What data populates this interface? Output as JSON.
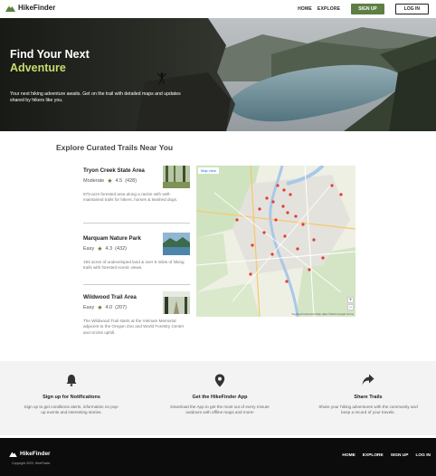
{
  "header": {
    "brand": "HikeFinder",
    "nav": {
      "home": "HOME",
      "explore": "EXPLORE"
    },
    "signup_label": "SIGN UP",
    "login_label": "LOG IN"
  },
  "hero": {
    "title_line1": "Find Your Next",
    "title_line2": "Adventure",
    "subtitle": "Your next hiking adventure awaits. Get on the trail with detailed maps and updates shared by hikers like you."
  },
  "trails_section": {
    "title": "Explore Curated Trails Near You",
    "trails": [
      {
        "name": "Tryon Creek State Area",
        "difficulty": "Moderate",
        "rating": "4.5",
        "reviews": "(428)",
        "description": "670-acre forested area along a ravine with well-maintained trails for hikers, horses & leashed dogs."
      },
      {
        "name": "Marquam Nature Park",
        "difficulty": "Easy",
        "rating": "4.3",
        "reviews": "(432)",
        "description": "193 acres of undeveloped land & over 5 miles of hiking trails with forested scenic views."
      },
      {
        "name": "Wildwood Trail Area",
        "difficulty": "Easy",
        "rating": "4.0",
        "reviews": "(207)",
        "description": "The Wildwood Trail starts at the Vietnam Memorial adjacent to the Oregon Zoo and World Forestry Center and circles uphill."
      }
    ]
  },
  "map": {
    "view_button": "Map view",
    "zoom_in": "+",
    "zoom_out": "−",
    "footer_text": "Keyboard shortcuts   Map data ©2024 Google   Terms"
  },
  "features": [
    {
      "icon": "bell-icon",
      "title": "Sign up for Notifications",
      "text": "Sign up to get conditions alerts, information on pop-up events and interesting stories."
    },
    {
      "icon": "location-pin-icon",
      "title": "Get the HikeFinder App",
      "text": "Download the App to get the most out of every minute outdoors with offline maps and more!"
    },
    {
      "icon": "share-icon",
      "title": "Share Trails",
      "text": "Share your hiking adventures with the community and keep a record of your travels."
    }
  ],
  "footer": {
    "brand": "HikeFinder",
    "copyright": "Copyright 2023, HikeFinder",
    "nav": {
      "home": "HOME",
      "explore": "EXPLORE",
      "signup": "SIGN UP",
      "login": "LOG IN"
    }
  },
  "colors": {
    "accent_green": "#5d7f45",
    "hero_accent": "#c9dc6e",
    "footer_bg": "#0c0c0c",
    "map_pin": "#e53935"
  }
}
